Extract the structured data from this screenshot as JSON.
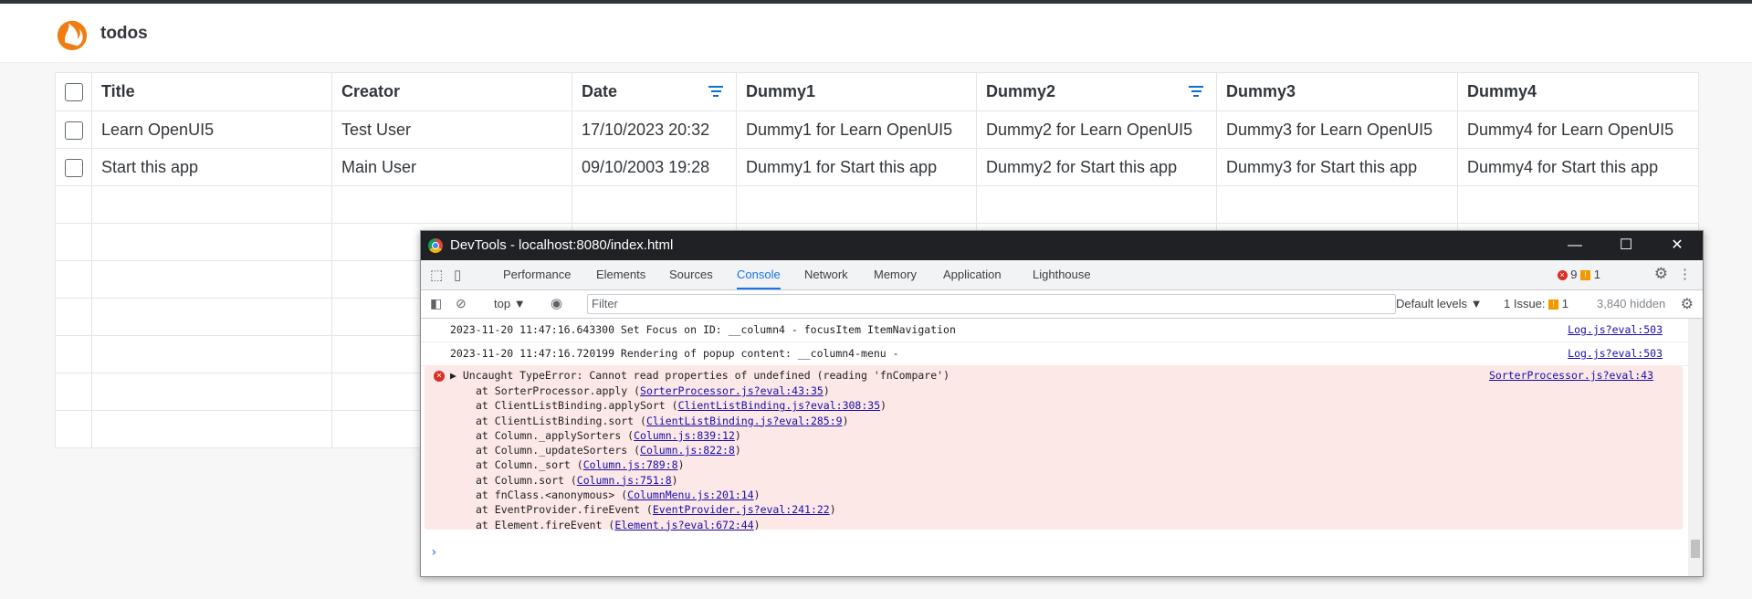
{
  "app": {
    "title": "todos"
  },
  "table": {
    "columns": [
      "Title",
      "Creator",
      "Date",
      "Dummy1",
      "Dummy2",
      "Dummy3",
      "Dummy4"
    ],
    "rows": [
      [
        "Learn OpenUI5",
        "Test User",
        "17/10/2023 20:32",
        "Dummy1 for Learn OpenUI5",
        "Dummy2 for Learn OpenUI5",
        "Dummy3 for Learn OpenUI5",
        "Dummy4 for Learn OpenUI5"
      ],
      [
        "Start this app",
        "Main User",
        "09/10/2003 19:28",
        "Dummy1 for Start this app",
        "Dummy2 for Start this app",
        "Dummy3 for Start this app",
        "Dummy4 for Start this app"
      ]
    ]
  },
  "devtools": {
    "window_title": "DevTools - localhost:8080/index.html",
    "tabs": [
      "Performance",
      "Elements",
      "Sources",
      "Console",
      "Network",
      "Memory",
      "Application",
      "Lighthouse"
    ],
    "active_tab": "Console",
    "error_count": "9",
    "warning_count": "1",
    "context": "top",
    "filter_placeholder": "Filter",
    "levels": "Default levels",
    "issues": "1 Issue:",
    "issues_count": "1",
    "hidden": "3,840 hidden",
    "messages": [
      {
        "text": "2023-11-20 11:47:16.643300 Set Focus on ID: __column4 - focusItem ItemNavigation",
        "source": "Log.js?eval:503"
      },
      {
        "text": "2023-11-20 11:47:16.720199 Rendering of popup content: __column4-menu -",
        "source": "Log.js?eval:503"
      }
    ],
    "error": {
      "head": "Uncaught TypeError: Cannot read properties of undefined (reading 'fnCompare')",
      "source": "SorterProcessor.js?eval:43",
      "stack": [
        {
          "pre": "at SorterProcessor.apply (",
          "link": "SorterProcessor.js?eval:43:35",
          "post": ")"
        },
        {
          "pre": "at ClientListBinding.applySort (",
          "link": "ClientListBinding.js?eval:308:35",
          "post": ")"
        },
        {
          "pre": "at ClientListBinding.sort (",
          "link": "ClientListBinding.js?eval:285:9",
          "post": ")"
        },
        {
          "pre": "at Column._applySorters (",
          "link": "Column.js:839:12",
          "post": ")"
        },
        {
          "pre": "at Column._updateSorters (",
          "link": "Column.js:822:8",
          "post": ")"
        },
        {
          "pre": "at Column._sort (",
          "link": "Column.js:789:8",
          "post": ")"
        },
        {
          "pre": "at Column.sort (",
          "link": "Column.js:751:8",
          "post": ")"
        },
        {
          "pre": "at fnClass.<anonymous> (",
          "link": "ColumnMenu.js:201:14",
          "post": ")"
        },
        {
          "pre": "at EventProvider.fireEvent (",
          "link": "EventProvider.js?eval:241:22",
          "post": ")"
        },
        {
          "pre": "at Element.fireEvent (",
          "link": "Element.js?eval:672:44",
          "post": ")"
        }
      ]
    },
    "prompt": "›"
  }
}
